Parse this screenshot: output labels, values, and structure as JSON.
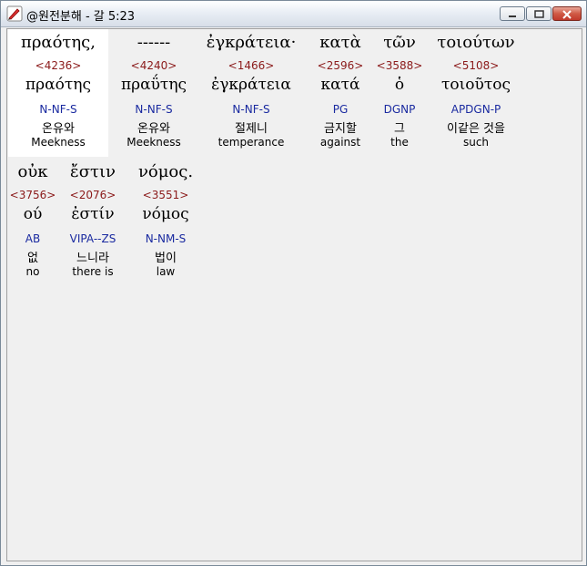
{
  "window": {
    "title": "@원전분해 - 갈 5:23",
    "icon": "app-brush-icon"
  },
  "verse_rows": [
    [
      {
        "greek": "πραότης,",
        "strong": "<4236>",
        "lemma": "πραότης",
        "parse": "N-NF-S",
        "korean": "온유와",
        "english": "Meekness",
        "selected": true
      },
      {
        "greek": "------",
        "strong": "<4240>",
        "lemma": "πραΰτης",
        "parse": "N-NF-S",
        "korean": "온유와",
        "english": "Meekness",
        "selected": false
      },
      {
        "greek": "ἐγκράτεια·",
        "strong": "<1466>",
        "lemma": "ἐγκράτεια",
        "parse": "N-NF-S",
        "korean": "절제니",
        "english": "temperance",
        "selected": false
      },
      {
        "greek": "κατὰ",
        "strong": "<2596>",
        "lemma": "κατά",
        "parse": "PG",
        "korean": "금지할",
        "english": "against",
        "selected": false
      },
      {
        "greek": "τῶν",
        "strong": "<3588>",
        "lemma": "ὁ",
        "parse": "DGNP",
        "korean": "그",
        "english": "the",
        "selected": false
      },
      {
        "greek": "τοιούτων",
        "strong": "<5108>",
        "lemma": "τοιοῦτος",
        "parse": "APDGN-P",
        "korean": "이같은 것을",
        "english": "such",
        "selected": false
      }
    ],
    [
      {
        "greek": "οὐκ",
        "strong": "<3756>",
        "lemma": "ού",
        "parse": "AB",
        "korean": "없",
        "english": "no",
        "selected": false
      },
      {
        "greek": "ἔστιν",
        "strong": "<2076>",
        "lemma": "ἐστίν",
        "parse": "VIPA--ZS",
        "korean": "느니라",
        "english": "there is",
        "selected": false
      },
      {
        "greek": "νόμος.",
        "strong": "<3551>",
        "lemma": "νόμος",
        "parse": "N-NM-S",
        "korean": "법이",
        "english": "law",
        "selected": false
      }
    ]
  ],
  "colors": {
    "strong_number": "#8b1a1a",
    "parse_code": "#1a2aa0",
    "selection": "#ffffff"
  }
}
